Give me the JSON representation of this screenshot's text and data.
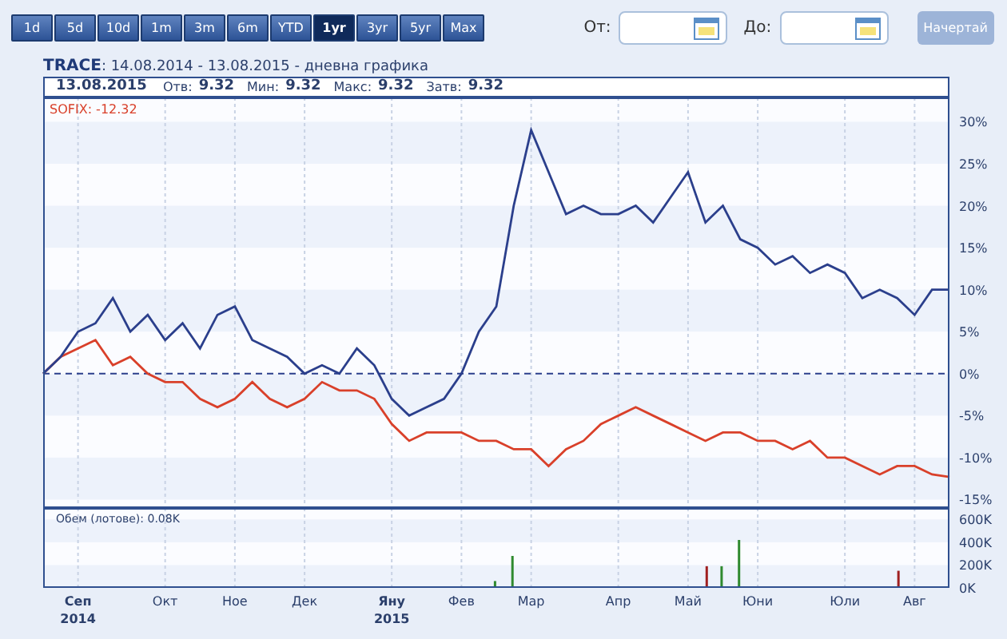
{
  "periods": [
    {
      "label": "1d",
      "selected": false
    },
    {
      "label": "5d",
      "selected": false
    },
    {
      "label": "10d",
      "selected": false
    },
    {
      "label": "1m",
      "selected": false
    },
    {
      "label": "3m",
      "selected": false
    },
    {
      "label": "6m",
      "selected": false
    },
    {
      "label": "YTD",
      "selected": false
    },
    {
      "label": "1yr",
      "selected": true
    },
    {
      "label": "3yr",
      "selected": false
    },
    {
      "label": "5yr",
      "selected": false
    },
    {
      "label": "Max",
      "selected": false
    }
  ],
  "date_from": {
    "label": "От:"
  },
  "date_to": {
    "label": "До:"
  },
  "draw_button": {
    "label": "Начертай",
    "disabled": true
  },
  "title": {
    "symbol": "TRACE",
    "text": ": 14.08.2014 - 13.08.2015 - дневна графика"
  },
  "quote": {
    "date": "13.08.2015",
    "fields": [
      {
        "label": "Отв:",
        "value": "9.32"
      },
      {
        "label": "Мин:",
        "value": "9.32"
      },
      {
        "label": "Макс:",
        "value": "9.32"
      },
      {
        "label": "Затв:",
        "value": "9.32"
      }
    ]
  },
  "price_chart": {
    "legend": "SOFIX: -12.32",
    "chart_data": {
      "type": "line",
      "ylim": [
        -16,
        32.8
      ],
      "grid": true,
      "ref_lines": [
        {
          "axis": "y",
          "value": 0,
          "color": "#2b3f8c"
        }
      ],
      "categories": [
        null,
        null,
        null,
        null,
        null,
        null,
        null,
        null,
        null,
        null,
        null,
        null,
        null,
        null,
        null,
        null,
        null,
        null,
        null,
        null,
        null,
        null,
        null,
        null,
        null,
        null,
        null,
        null,
        null,
        null,
        null,
        null,
        null,
        null,
        null,
        null,
        null,
        null,
        null,
        null,
        null,
        null,
        null,
        null,
        null,
        null,
        null,
        null,
        null,
        null,
        null,
        null,
        null
      ],
      "yticks": [
        {
          "value": 30,
          "label": "30%"
        },
        {
          "value": 25,
          "label": "25%"
        },
        {
          "value": 20,
          "label": "20%"
        },
        {
          "value": 15,
          "label": "15%"
        },
        {
          "value": 10,
          "label": "10%"
        },
        {
          "value": 5,
          "label": "5%"
        },
        {
          "value": 0,
          "label": "0%"
        },
        {
          "value": -5,
          "label": "-5%"
        },
        {
          "value": -10,
          "label": "-10%"
        },
        {
          "value": -15,
          "label": "-15%"
        }
      ],
      "series": [
        {
          "color": "#2b3f8c",
          "values": [
            0,
            2,
            5,
            6,
            9,
            5,
            7,
            4,
            6,
            3,
            7,
            8,
            4,
            3,
            2,
            0,
            1,
            0,
            3,
            1,
            -3,
            -5,
            -4,
            -3,
            0,
            5,
            8,
            20,
            29,
            24,
            19,
            20,
            19,
            19,
            20,
            18,
            21,
            24,
            18,
            20,
            16,
            15,
            13,
            14,
            12,
            13,
            12,
            9,
            10,
            9,
            7,
            10,
            10
          ]
        },
        {
          "color": "#d9402a",
          "values": [
            0,
            2,
            3,
            4,
            1,
            2,
            0,
            -1,
            -1,
            -3,
            -4,
            -3,
            -1,
            -3,
            -4,
            -3,
            -1,
            -2,
            -2,
            -3,
            -6,
            -8,
            -7,
            -7,
            -7,
            -8,
            -8,
            -9,
            -9,
            -11,
            -9,
            -8,
            -6,
            -5,
            -4,
            -5,
            -6,
            -7,
            -8,
            -7,
            -7,
            -8,
            -8,
            -9,
            -8,
            -10,
            -10,
            -11,
            -12,
            -11,
            -11,
            -12,
            -12.3
          ]
        }
      ]
    }
  },
  "volume_chart": {
    "legend": "Обем (лотове): 0.08K",
    "chart_data": {
      "type": "bar",
      "ylim": [
        0,
        700000
      ],
      "stacked": false,
      "grid": true,
      "categories": [
        null,
        null,
        "Сеп 2014",
        null,
        null,
        null,
        null,
        "Окт",
        null,
        null,
        null,
        "Ное",
        null,
        null,
        null,
        "Дек",
        null,
        null,
        null,
        null,
        "Яну 2015",
        null,
        null,
        null,
        "Фев",
        null,
        null,
        null,
        "Мар",
        null,
        null,
        null,
        null,
        "Апр",
        null,
        null,
        null,
        "Май",
        null,
        null,
        null,
        "Юни",
        null,
        null,
        null,
        null,
        "Юли",
        null,
        null,
        null,
        "Авг",
        null,
        null
      ],
      "yticks": [
        {
          "value": 600000,
          "label": "600K"
        },
        {
          "value": 400000,
          "label": "400K"
        },
        {
          "value": 200000,
          "label": "200K"
        },
        {
          "value": 0,
          "label": "0K"
        }
      ],
      "series": [
        {
          "color": "#2f8a2f",
          "values": [
            null,
            null,
            null,
            null,
            null,
            null,
            null,
            null,
            null,
            null,
            null,
            null,
            null,
            null,
            null,
            null,
            null,
            null,
            null,
            null,
            null,
            null,
            null,
            null,
            null,
            null,
            60000,
            280000,
            null,
            null,
            null,
            null,
            null,
            null,
            null,
            null,
            null,
            null,
            null,
            190000,
            420000,
            null,
            null,
            null,
            null,
            null,
            null,
            null,
            null,
            null,
            null,
            null,
            null
          ]
        },
        {
          "color": "#a02020",
          "values": [
            null,
            null,
            null,
            null,
            null,
            null,
            null,
            null,
            null,
            null,
            null,
            null,
            null,
            null,
            null,
            null,
            null,
            null,
            null,
            null,
            null,
            null,
            null,
            null,
            null,
            null,
            null,
            null,
            null,
            null,
            null,
            null,
            null,
            null,
            null,
            null,
            null,
            null,
            190000,
            null,
            null,
            null,
            null,
            null,
            null,
            null,
            null,
            null,
            null,
            150000,
            null,
            null,
            null
          ]
        }
      ]
    }
  }
}
